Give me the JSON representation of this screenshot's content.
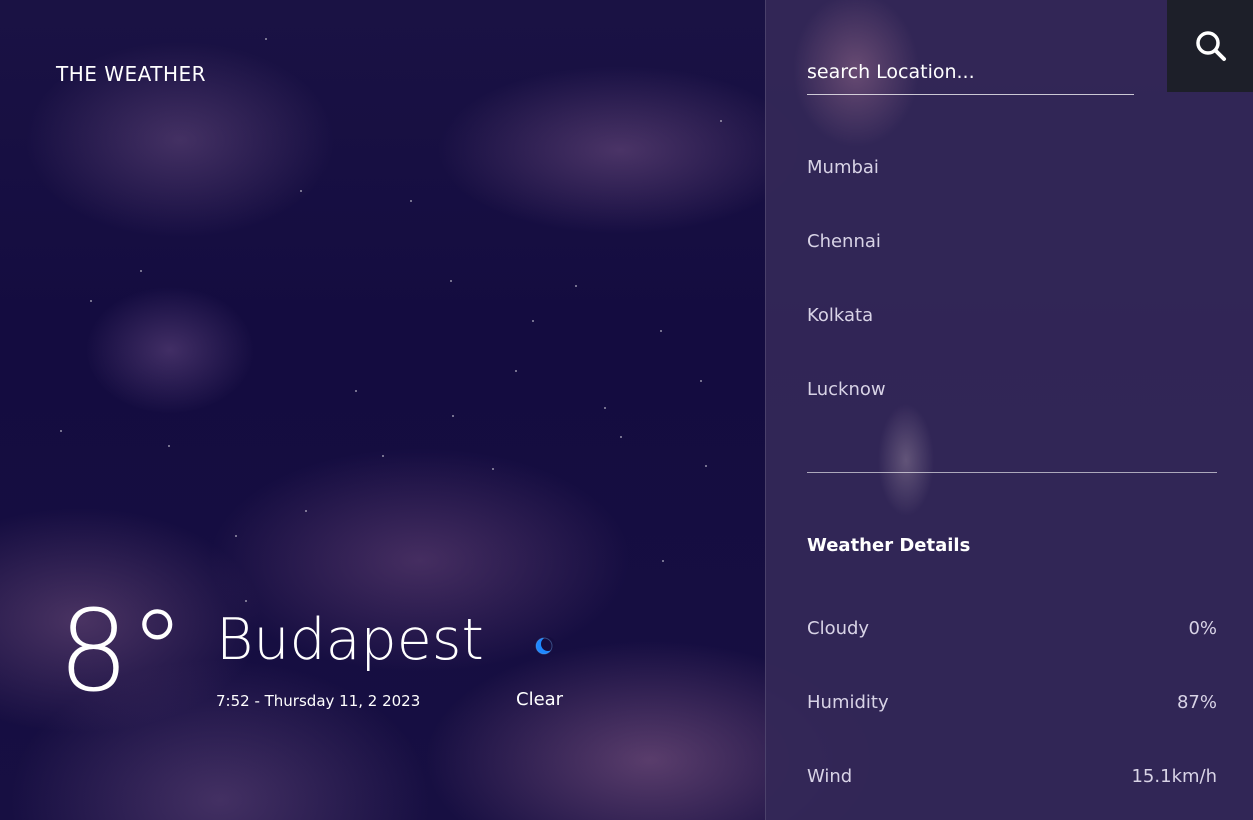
{
  "brand": "THE WEATHER",
  "current": {
    "temperature": "8°",
    "city": "Budapest",
    "datetime": "7:52 - Thursday 11, 2 2023",
    "condition": "Clear",
    "icon": "moon-icon"
  },
  "search": {
    "placeholder": "search Location...",
    "icon": "search-icon"
  },
  "cities": [
    "Mumbai",
    "Chennai",
    "Kolkata",
    "Lucknow"
  ],
  "details": {
    "title": "Weather Details",
    "rows": [
      {
        "label": "Cloudy",
        "value": "0%"
      },
      {
        "label": "Humidity",
        "value": "87%"
      },
      {
        "label": "Wind",
        "value": "15.1km/h"
      }
    ]
  },
  "colors": {
    "background": "#140c40",
    "panel": "#342858",
    "search_button": "#1d1f29",
    "moon_icon": "#1e88ff"
  }
}
